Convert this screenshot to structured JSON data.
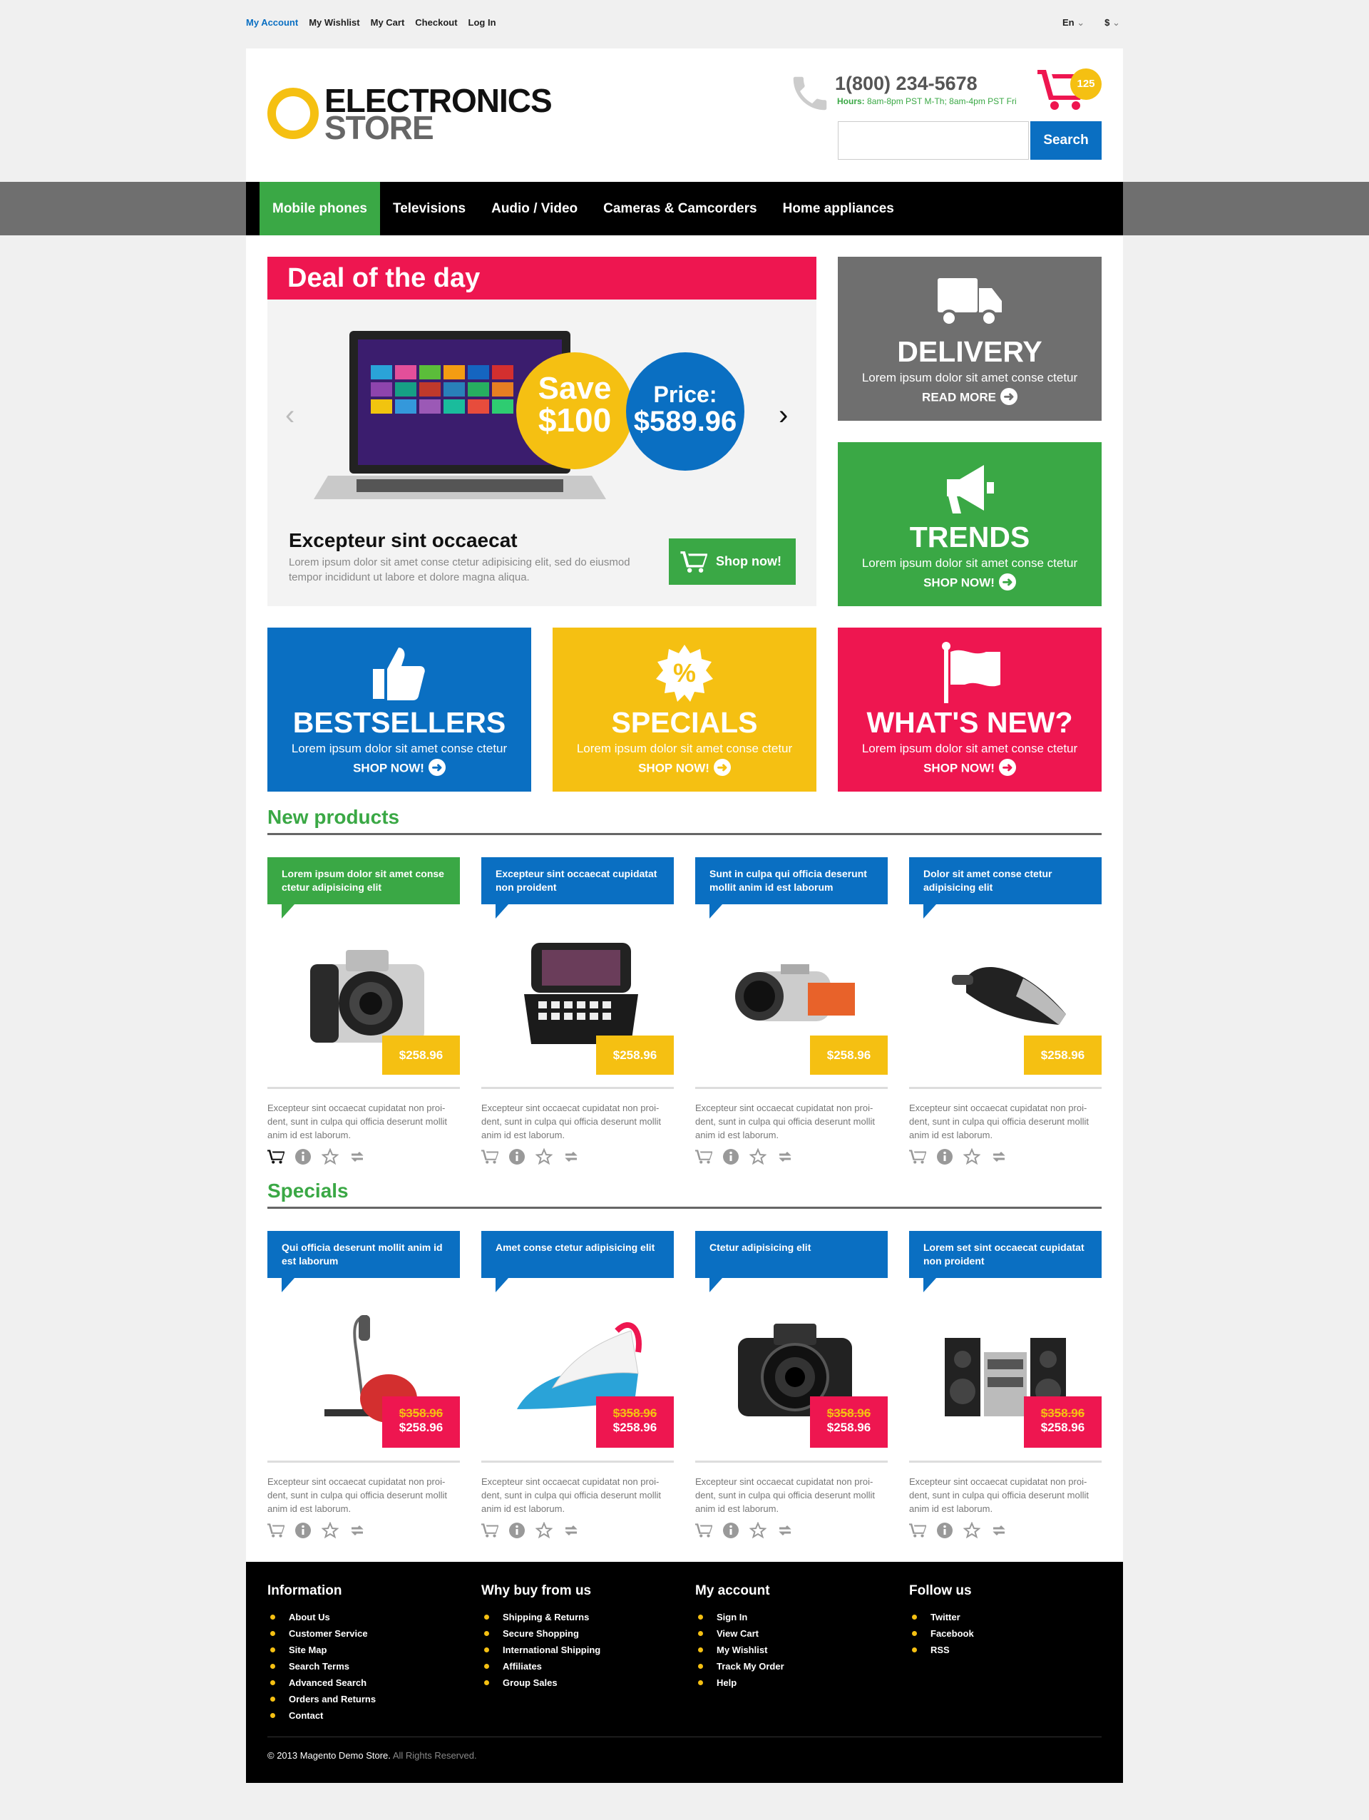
{
  "top_links": [
    "My Account",
    "My Wishlist",
    "My Cart",
    "Checkout",
    "Log In"
  ],
  "lang": "En",
  "currency": "$",
  "logo": {
    "line1": "ELECTRONICS",
    "line2": "STORE"
  },
  "phone": "1(800) 234-5678",
  "hours_label": "Hours:",
  "hours_text": "8am-8pm PST M-Th; 8am-4pm PST Fri",
  "cart_count": "125",
  "search": {
    "placeholder": "",
    "button": "Search"
  },
  "nav": [
    "Mobile phones",
    "Televisions",
    "Audio / Video",
    "Cameras & Camcorders",
    "Home appliances"
  ],
  "deal": {
    "title": "Deal of the day",
    "save_l1": "Save",
    "save_l2": "$100",
    "price_l1": "Price:",
    "price_l2": "$589.96",
    "name": "Excepteur sint occaecat",
    "desc": "Lorem ipsum dolor sit amet conse ctetur adipisicing elit, sed do eiusmod tempor incididunt ut labore et dolore magna aliqua.",
    "button": "Shop now!"
  },
  "tiles": [
    {
      "title": "DELIVERY",
      "desc": "Lorem ipsum dolor sit amet conse ctetur",
      "link": "READ MORE",
      "color": "#6f6f6f"
    },
    {
      "title": "TRENDS",
      "desc": "Lorem ipsum dolor sit amet conse ctetur",
      "link": "SHOP NOW!",
      "color": "#3aa845"
    },
    {
      "title": "BESTSELLERS",
      "desc": "Lorem ipsum dolor sit amet conse ctetur",
      "link": "SHOP NOW!",
      "color": "#0a6fc2"
    },
    {
      "title": "SPECIALS",
      "desc": "Lorem ipsum dolor sit amet conse ctetur",
      "link": "SHOP NOW!",
      "color": "#f5c012"
    },
    {
      "title": "WHAT'S NEW?",
      "desc": "Lorem ipsum dolor sit amet conse ctetur",
      "link": "SHOP NOW!",
      "color": "#ee1650"
    }
  ],
  "new_products": {
    "title": "New products",
    "items": [
      {
        "tag": "Lorem ipsum dolor sit amet conse ctetur adipisicing elit",
        "price": "$258.96",
        "desc": "Excepteur sint occaecat cupidatat non proi-dent, sunt in culpa qui officia deserunt mollit anim id est laborum."
      },
      {
        "tag": "Excepteur sint occaecat cupidatat non proident",
        "price": "$258.96",
        "desc": "Excepteur sint occaecat cupidatat non proi-dent, sunt in culpa qui officia deserunt mollit anim id est laborum."
      },
      {
        "tag": "Sunt in culpa qui officia deserunt mollit anim id est laborum",
        "price": "$258.96",
        "desc": "Excepteur sint occaecat cupidatat non proi-dent, sunt in culpa qui officia deserunt mollit anim id est laborum."
      },
      {
        "tag": "Dolor sit amet conse ctetur adipisicing elit",
        "price": "$258.96",
        "desc": "Excepteur sint occaecat cupidatat non proi-dent, sunt in culpa qui officia deserunt mollit anim id est laborum."
      }
    ]
  },
  "specials": {
    "title": "Specials",
    "items": [
      {
        "tag": "Qui officia deserunt mollit anim id est laborum",
        "old_price": "$358.96",
        "price": "$258.96",
        "desc": "Excepteur sint occaecat cupidatat non proi-dent, sunt in culpa qui officia deserunt mollit anim id est laborum."
      },
      {
        "tag": "Amet conse ctetur adipisicing elit",
        "old_price": "$358.96",
        "price": "$258.96",
        "desc": "Excepteur sint occaecat cupidatat non proi-dent, sunt in culpa qui officia deserunt mollit anim id est laborum."
      },
      {
        "tag": "Ctetur adipisicing elit",
        "old_price": "$358.96",
        "price": "$258.96",
        "desc": "Excepteur sint occaecat cupidatat non proi-dent, sunt in culpa qui officia deserunt mollit anim id est laborum."
      },
      {
        "tag": "Lorem set sint occaecat cupidatat non proident",
        "old_price": "$358.96",
        "price": "$258.96",
        "desc": "Excepteur sint occaecat cupidatat non proi-dent, sunt in culpa qui officia deserunt mollit anim id est laborum."
      }
    ]
  },
  "footer": {
    "columns": [
      {
        "title": "Information",
        "links": [
          "About Us",
          "Customer Service",
          "Site Map",
          "Search Terms",
          "Advanced Search",
          "Orders and Returns",
          "Contact"
        ]
      },
      {
        "title": "Why buy from us",
        "links": [
          "Shipping & Returns",
          "Secure Shopping",
          "International Shipping",
          "Affiliates",
          "Group Sales"
        ]
      },
      {
        "title": "My account",
        "links": [
          "Sign In",
          "View Cart",
          "My Wishlist",
          "Track My Order",
          "Help"
        ]
      },
      {
        "title": "Follow us",
        "links": [
          "Twitter",
          "Facebook",
          "RSS"
        ]
      }
    ],
    "copyright": "© 2013 Magento Demo Store.",
    "rights": "All Rights Reserved."
  },
  "colors": {
    "green": "#3aa845",
    "blue": "#0a6fc2",
    "yellow": "#f5c012",
    "red": "#ee1650",
    "gray": "#6f6f6f"
  }
}
